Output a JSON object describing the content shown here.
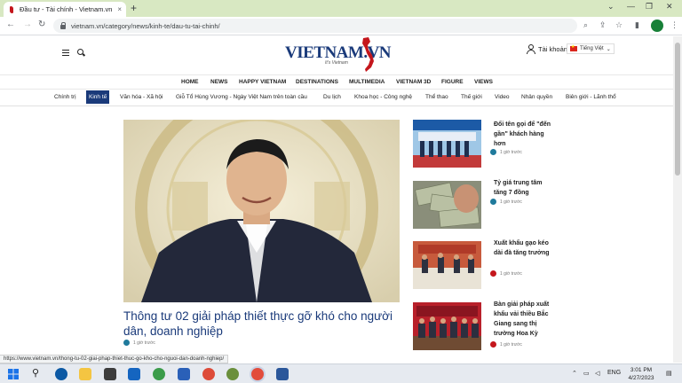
{
  "browser": {
    "tab_title": "Đầu tư - Tài chính - Vietnam.vn",
    "tab_close": "×",
    "new_tab": "+",
    "url": "vietnam.vn/category/news/kinh-te/dau-tu-tai-chinh/",
    "status_url": "https://www.vietnam.vn/thong-tu-02-giai-phap-thiet-thuc-go-kho-cho-nguoi-dan-doanh-nghiep/",
    "icons": [
      "back-icon",
      "forward-icon",
      "reload-icon",
      "lock-icon",
      "zoom-icon",
      "share-icon",
      "star-icon",
      "sidebar-icon",
      "extension-icon",
      "profile-icon",
      "menu-icon"
    ]
  },
  "site": {
    "logo": "VIETNAM.VN",
    "tagline": "It's Vietnam",
    "account": "Tài khoản",
    "language": "Tiếng Việt",
    "brand_colors": {
      "navy": "#1a3a7a",
      "red": "#c4161c"
    }
  },
  "topnav": [
    "HOME",
    "NEWS",
    "HAPPY VIETNAM",
    "DESTINATIONS",
    "MULTIMEDIA",
    "VIETNAM 3D",
    "FIGURE",
    "VIEWS"
  ],
  "catnav": [
    "Chính trị",
    "Kinh tế",
    "Văn hóa - Xã hội",
    "Giỗ Tổ Hùng Vương - Ngày Việt Nam trên toàn cầu",
    "Du lịch",
    "Khoa học - Công nghệ",
    "Thể thao",
    "Thế giới",
    "Video",
    "Nhân quyền",
    "Biên giới - Lãnh thổ"
  ],
  "catnav_active": "Kinh tế",
  "hero": {
    "title": "Thông tư 02 giải pháp thiết thực gỡ khó cho người dân, doanh nghiệp",
    "time": "1 giờ trước"
  },
  "side_articles": [
    {
      "title": "Đổi tên gọi để \"đến gần\" khách hàng hơn",
      "time": "1 giờ trước"
    },
    {
      "title": "Tỷ giá trung tâm tăng 7 đồng",
      "time": "1 giờ trước"
    },
    {
      "title": "Xuất khẩu gạo kéo dài đà tăng trưởng",
      "time": "1 giờ trước"
    },
    {
      "title": "Bàn giải pháp xuất khẩu vải thiều Bắc Giang sang thị trường Hoa Kỳ",
      "time": "1 giờ trước"
    }
  ],
  "taskbar": {
    "language": "ENG",
    "time": "3:01 PM",
    "date": "4/27/2023"
  }
}
